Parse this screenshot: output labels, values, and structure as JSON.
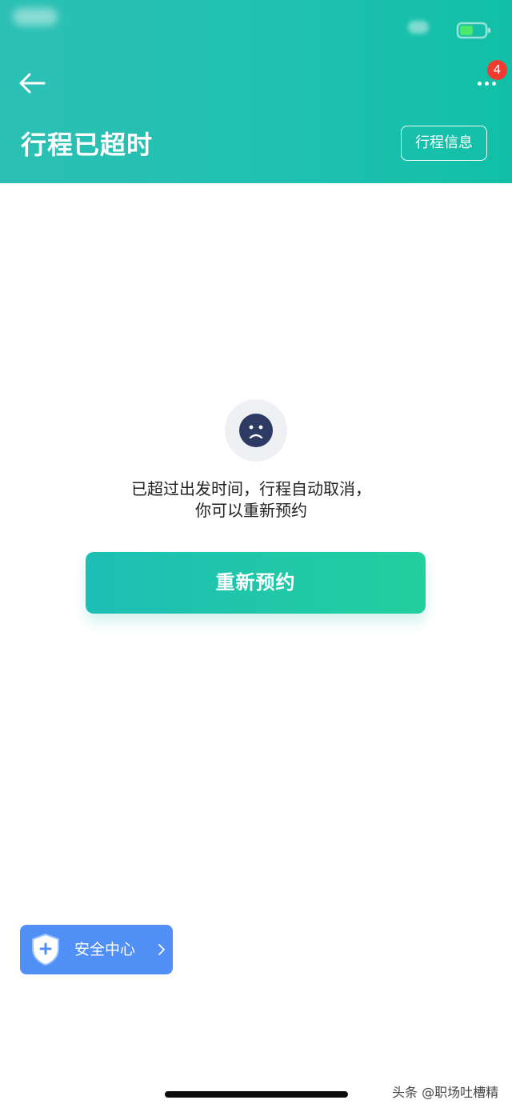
{
  "status_bar": {
    "battery_color": "#4ee86a"
  },
  "header": {
    "title": "行程已超时",
    "trip_info_label": "行程信息",
    "notification_count": "4",
    "gradient_colors": [
      "#2cc0b4",
      "#11bfa6"
    ]
  },
  "icons": {
    "back": "arrow-left-icon",
    "more": "more-dots-icon",
    "status": "sad-face-icon",
    "safety": "shield-plus-icon",
    "chevron": "chevron-right-icon"
  },
  "main": {
    "message_line1": "已超过出发时间，行程自动取消，",
    "message_line2": "你可以重新预约",
    "rebook_label": "重新预约",
    "rebook_colors": [
      "#1dbeb5",
      "#22cf9e"
    ]
  },
  "safety_center": {
    "label": "安全中心",
    "color": "#4f8ff6"
  },
  "watermark": "头条 @职场吐槽精"
}
